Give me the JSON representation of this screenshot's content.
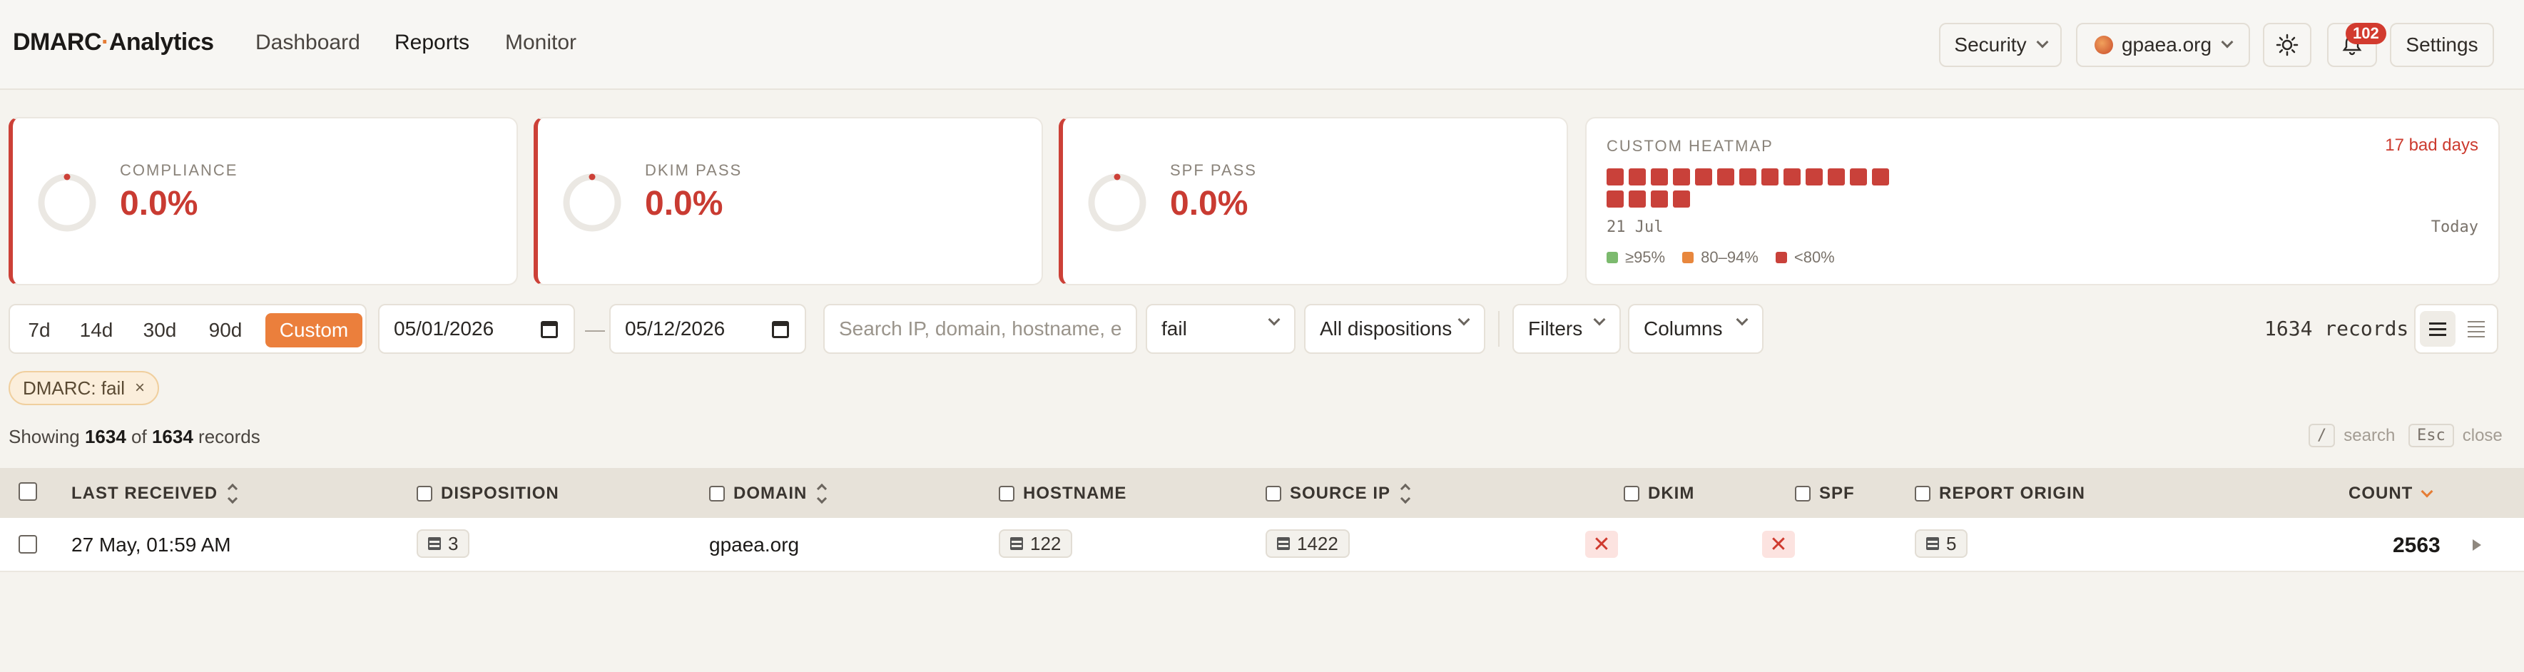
{
  "app": {
    "brand_left": "DMARC",
    "brand_sep": "·",
    "brand_right": "Analytics"
  },
  "nav": {
    "items": [
      {
        "label": "Dashboard",
        "active": false
      },
      {
        "label": "Reports",
        "active": true
      },
      {
        "label": "Monitor",
        "active": false
      }
    ]
  },
  "toolbar": {
    "view_select": "Security",
    "org_select": "gpaea.org",
    "theme_icon": "sun-icon",
    "notifications_count": "102",
    "settings_label": "Settings"
  },
  "stats": [
    {
      "label": "COMPLIANCE",
      "value": "0.0%"
    },
    {
      "label": "DKIM PASS",
      "value": "0.0%"
    },
    {
      "label": "SPF PASS",
      "value": "0.0%"
    }
  ],
  "heatmap": {
    "title": "CUSTOM HEATMAP",
    "bad_days": "17 bad days",
    "start_label": "21 Jul",
    "end_label": "Today",
    "cells": 17,
    "colors": {
      "good": "#7cba6e",
      "mid": "#e8873d",
      "bad": "#c9413a"
    },
    "legend": [
      {
        "label": "≥95%",
        "color": "#7cba6e"
      },
      {
        "label": "80–94%",
        "color": "#e8873d"
      },
      {
        "label": "<80%",
        "color": "#c9413a"
      }
    ]
  },
  "filters": {
    "ranges": [
      "7d",
      "14d",
      "30d",
      "90d",
      "Custom"
    ],
    "active_range": "Custom",
    "date_from": "05/01/2026",
    "date_sep": "—",
    "date_to": "05/12/2026",
    "search_placeholder": "Search IP, domain, hostname, e",
    "result_select": "fail",
    "disposition_select": "All dispositions",
    "filters_label": "Filters",
    "columns_label": "Columns",
    "records_count": "1634 records"
  },
  "active_chip": {
    "label": "DMARC: fail",
    "remove": "×"
  },
  "summary": {
    "prefix": "Showing",
    "shown": "1634",
    "of": "of",
    "total": "1634",
    "suffix": "records"
  },
  "shortcuts": [
    {
      "key": "/",
      "label": "search"
    },
    {
      "key": "Esc",
      "label": "close"
    }
  ],
  "table": {
    "columns": [
      "LAST RECEIVED",
      "DISPOSITION",
      "DOMAIN",
      "HOSTNAME",
      "SOURCE IP",
      "DKIM",
      "SPF",
      "REPORT ORIGIN",
      "COUNT"
    ],
    "rows": [
      {
        "last_received": "27 May, 01:59 AM",
        "disposition": "3",
        "domain": "gpaea.org",
        "hostname": "122",
        "source_ip": "1422",
        "dkim": "✕",
        "spf": "✕",
        "report_origin": "5",
        "count": "2563"
      }
    ]
  }
}
